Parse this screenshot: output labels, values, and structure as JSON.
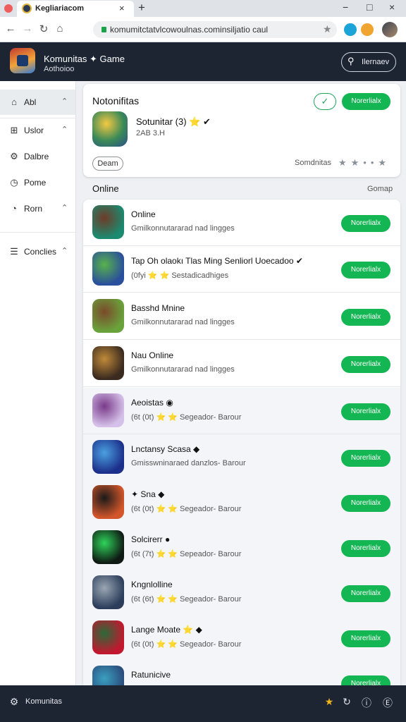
{
  "browser": {
    "tab_title": "Kegliariacom",
    "tab_close": "×",
    "new_tab": "+",
    "url": "komumitctatvlcowoulnas.cominsiljatio caul",
    "win_min": "−",
    "win_max": "□",
    "win_close": "×"
  },
  "header": {
    "title": "Komunitas ✦ Game",
    "subtitle": "Aothoioo",
    "search_label": "Ilernaev"
  },
  "sidebar": {
    "items": [
      {
        "label": "Abl",
        "icon": "home-icon",
        "glyph": "⌂",
        "chevron": "⌃"
      },
      {
        "label": "Uslor",
        "icon": "grid-icon",
        "glyph": "⊞",
        "chevron": "⌃"
      },
      {
        "label": "Dalbre",
        "icon": "gear-icon",
        "glyph": "⚙",
        "chevron": ""
      },
      {
        "label": "Pome",
        "icon": "clock-icon",
        "glyph": "◷",
        "chevron": ""
      },
      {
        "label": "Rorn",
        "icon": "compass-icon",
        "glyph": "◔",
        "chevron": "⌃"
      },
      {
        "label": "Conclies",
        "icon": "list-icon",
        "glyph": "☰",
        "chevron": "⌃"
      }
    ]
  },
  "featured": {
    "title": "Notonifitas",
    "check": "✓",
    "button": "Norerlialx",
    "game_name": "Sotunitar (3) ⭐ ✔",
    "game_meta": "2AB 3.H",
    "tag": "Deam",
    "sort_label": "Somdnitas",
    "stars": "★★••★"
  },
  "section": {
    "title": "Online",
    "link": "Gomap"
  },
  "games": [
    {
      "name": "Online",
      "meta": "Gmilkonnutararad nad lingges",
      "button": "Norerlialx",
      "colors": [
        "#1b8a6f",
        "#6f3b28"
      ]
    },
    {
      "name": "Tap Oh olaokı Tlas Ming Senliorl Uoecadoo ✔",
      "meta": "(0fyi ⭐ ⭐ Sestadicadhiges",
      "button": "Norerlialx",
      "colors": [
        "#2a4f9c",
        "#58b24a"
      ]
    },
    {
      "name": "Basshd Mnine",
      "meta": "Gmilkonnutararad nad lingges",
      "button": "Norerlialx",
      "colors": [
        "#6aa33c",
        "#7a4a2a"
      ]
    },
    {
      "name": "Nau Online",
      "meta": "Gmilkonnutararad nad lingges",
      "button": "Norerlialx",
      "colors": [
        "#3a2a1f",
        "#c08a3a"
      ]
    },
    {
      "name": "Aeoistas ◉",
      "meta": "(6t (0t) ⭐ ⭐ Segeador- Barour",
      "button": "Norerlialx",
      "colors": [
        "#d4c0e8",
        "#7a3a8a"
      ]
    },
    {
      "name": "Lnctansy Scasa ◆",
      "meta": "Gmisswninaraed danzlos- Barour",
      "button": "Norerlialx",
      "colors": [
        "#1c2f8a",
        "#4aa0e0"
      ]
    },
    {
      "name": "✦ Sna ◆",
      "meta": "(6t (0t) ⭐ ⭐ Segeador- Barour",
      "button": "Norerlialx",
      "colors": [
        "#d2562a",
        "#1a1a1a"
      ]
    },
    {
      "name": "Solcirerr ●",
      "meta": "(6t (7t) ⭐ ⭐ Sepeador- Barour",
      "button": "Norerlialx",
      "colors": [
        "#0f1a14",
        "#2fd35a"
      ]
    },
    {
      "name": "Kngnlolline",
      "meta": "(6t (6t) ⭐ ⭐ Segeador- Barour",
      "button": "Norerlialx",
      "colors": [
        "#2b3d5a",
        "#9aa6b3"
      ]
    },
    {
      "name": "Lange Moate ⭐ ◆",
      "meta": "(6t (0t) ⭐ ⭐ Segeador- Barour",
      "button": "Norerlialx",
      "colors": [
        "#c2182f",
        "#2a6a3a"
      ]
    },
    {
      "name": "Ratunicive",
      "meta": "",
      "button": "Norerlialx",
      "colors": [
        "#2a4a7a",
        "#3aa0c0"
      ]
    }
  ],
  "bottom": {
    "label": "Komunitas",
    "icons": [
      "settings-icon",
      "star-icon",
      "refresh-icon",
      "bolt-icon",
      "exit-icon"
    ]
  },
  "colors": {
    "accent_green": "#14b553",
    "header_dark": "#1d2533"
  }
}
